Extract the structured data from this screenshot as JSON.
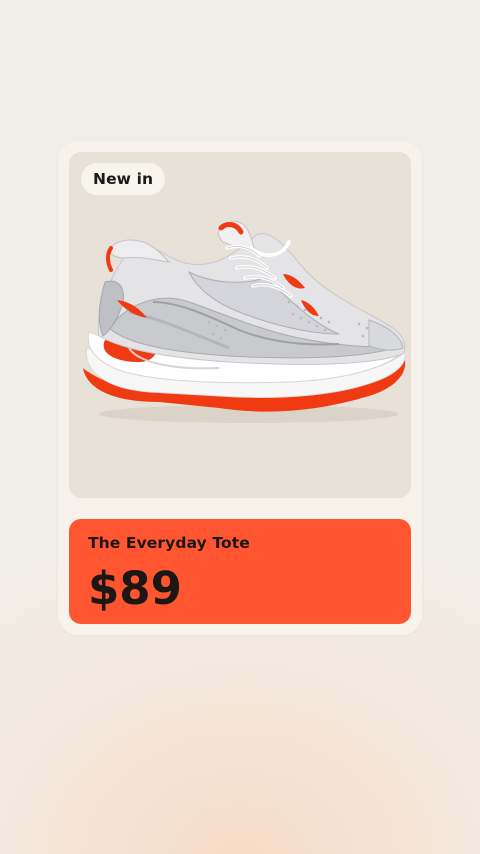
{
  "card": {
    "badge": "New in",
    "product_name": "The Everyday Tote",
    "price": "$89",
    "image_icon": "sneaker-image"
  },
  "colors": {
    "accent": "#ff5531",
    "card_bg": "#f7f3ec",
    "image_bg": "#e8e1d8",
    "text_dark": "#1c1714"
  }
}
